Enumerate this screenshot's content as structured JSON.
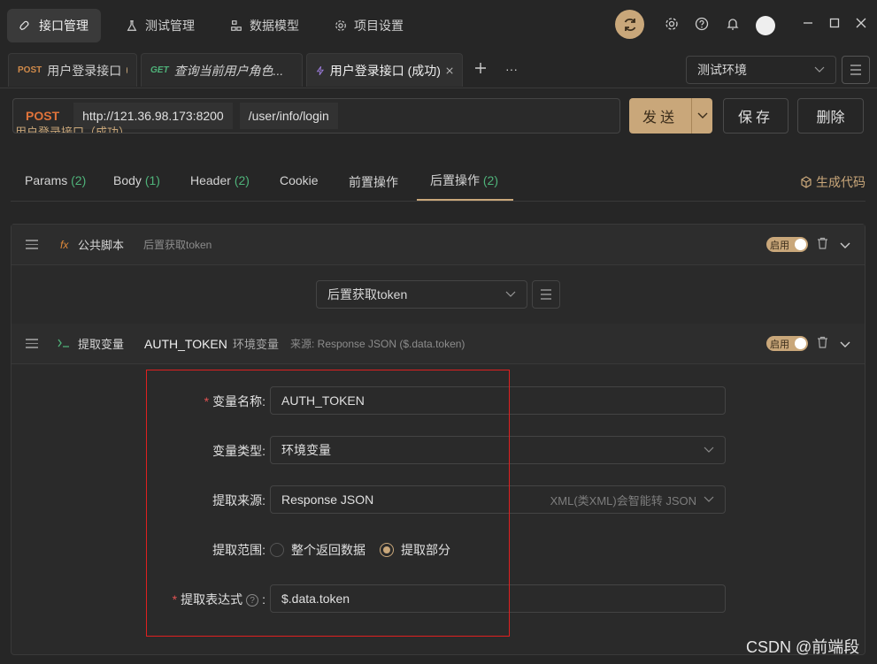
{
  "nav": {
    "tabs": [
      {
        "label": "接口管理",
        "icon": "rocket-icon"
      },
      {
        "label": "测试管理",
        "icon": "flask-icon"
      },
      {
        "label": "数据模型",
        "icon": "model-icon"
      },
      {
        "label": "项目设置",
        "icon": "gear-icon"
      }
    ]
  },
  "tabs": {
    "items": [
      {
        "method": "POST",
        "label": "用户登录接口"
      },
      {
        "method": "GET",
        "label": "查询当前用户角色..."
      },
      {
        "label": "用户登录接口 (成功)"
      }
    ],
    "env": "测试环境"
  },
  "request": {
    "method": "POST",
    "host": "http://121.36.98.173:8200",
    "path": "/user/info/login",
    "send": "发送",
    "save": "保存",
    "delete": "删除",
    "subtitle": "用户登录接口（成功）"
  },
  "subtabs": {
    "params": "Params",
    "params_count": "(2)",
    "body": "Body",
    "body_count": "(1)",
    "header": "Header",
    "header_count": "(2)",
    "cookie": "Cookie",
    "pre": "前置操作",
    "post": "后置操作",
    "post_count": "(2)",
    "gen_code": "生成代码"
  },
  "script": {
    "fx": "fx",
    "title": "公共脚本",
    "desc": "后置获取token",
    "toggle": "启用",
    "select": "后置获取token"
  },
  "extract": {
    "title": "提取变量",
    "var": "AUTH_TOKEN",
    "type": "环境变量",
    "source": "来源: Response JSON ($.data.token)",
    "toggle": "启用"
  },
  "form": {
    "name_label": "变量名称:",
    "name_value": "AUTH_TOKEN",
    "type_label": "变量类型:",
    "type_value": "环境变量",
    "source_label": "提取来源:",
    "source_value": "Response JSON",
    "source_hint": "XML(类XML)会智能转 JSON",
    "range_label": "提取范围:",
    "range_all": "整个返回数据",
    "range_part": "提取部分",
    "expr_label": "提取表达式",
    "expr_colon": ":",
    "expr_value": "$.data.token"
  },
  "watermark": "CSDN @前端段",
  "colors": {
    "accent": "#c9a77a",
    "post": "#e0733a",
    "get": "#4fb37a",
    "background": "#262626"
  }
}
